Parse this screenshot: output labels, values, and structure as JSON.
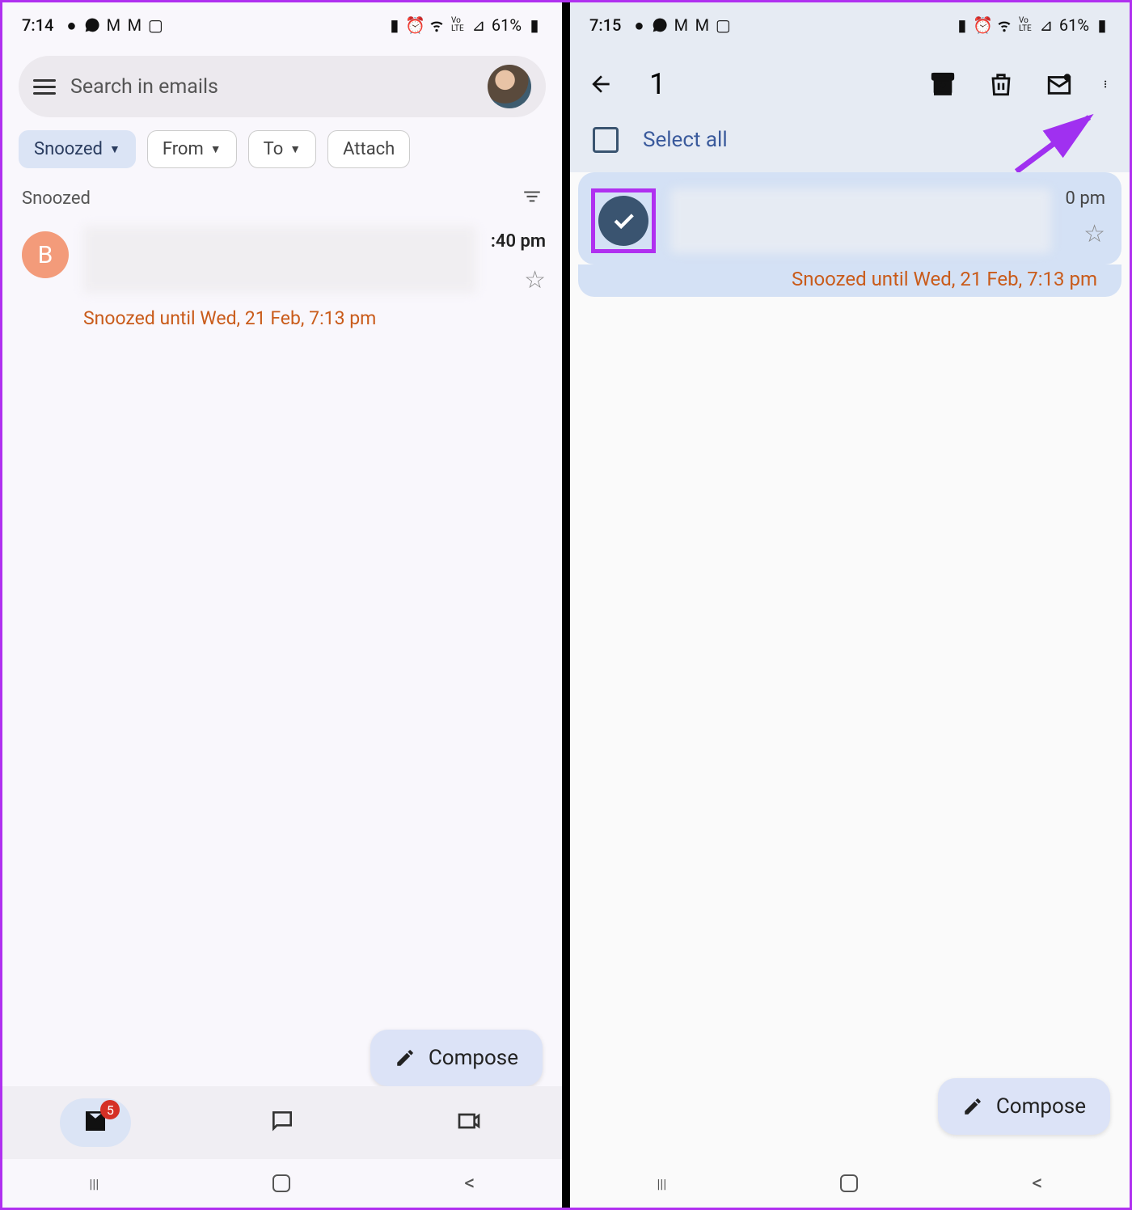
{
  "left": {
    "status": {
      "time": "7:14",
      "battery": "61%"
    },
    "search_placeholder": "Search in emails",
    "chips": {
      "snoozed": "Snoozed",
      "from": "From",
      "to": "To",
      "attach": "Attach"
    },
    "section_label": "Snoozed",
    "email": {
      "avatar_letter": "B",
      "time": ":40 pm",
      "snooze": "Snoozed until Wed, 21 Feb, 7:13 pm"
    },
    "compose": "Compose",
    "badge_count": "5"
  },
  "right": {
    "status": {
      "time": "7:15",
      "battery": "61%"
    },
    "selected_count": "1",
    "select_all": "Select all",
    "email": {
      "time": "0 pm",
      "snooze": "Snoozed until Wed, 21 Feb, 7:13 pm"
    },
    "compose": "Compose"
  }
}
